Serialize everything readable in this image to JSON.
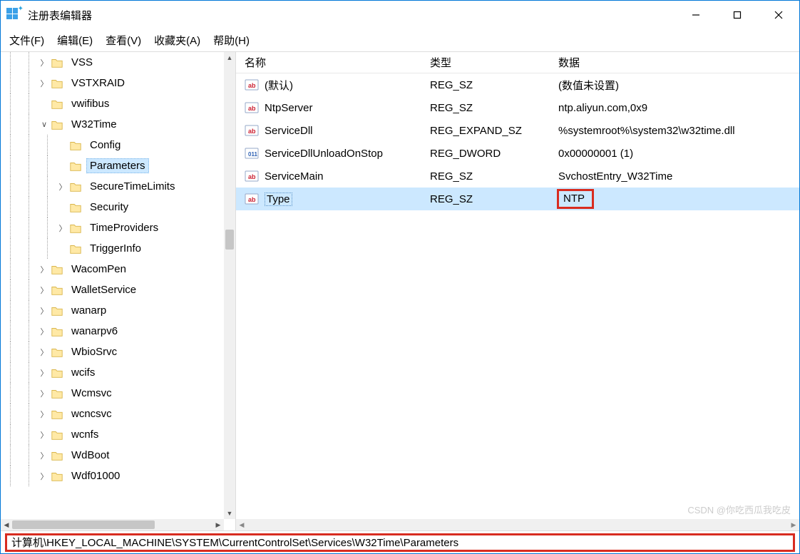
{
  "window": {
    "title": "注册表编辑器"
  },
  "menu": {
    "file": "文件(F)",
    "edit": "编辑(E)",
    "view": "查看(V)",
    "fav": "收藏夹(A)",
    "help": "帮助(H)"
  },
  "tree": [
    {
      "d": 2,
      "t": ">",
      "l": "VSS"
    },
    {
      "d": 2,
      "t": ">",
      "l": "VSTXRAID"
    },
    {
      "d": 2,
      "t": "",
      "l": "vwifibus"
    },
    {
      "d": 2,
      "t": "v",
      "l": "W32Time"
    },
    {
      "d": 3,
      "t": "",
      "l": "Config"
    },
    {
      "d": 3,
      "t": "",
      "l": "Parameters",
      "sel": true
    },
    {
      "d": 3,
      "t": ">",
      "l": "SecureTimeLimits"
    },
    {
      "d": 3,
      "t": "",
      "l": "Security"
    },
    {
      "d": 3,
      "t": ">",
      "l": "TimeProviders"
    },
    {
      "d": 3,
      "t": "",
      "l": "TriggerInfo"
    },
    {
      "d": 2,
      "t": ">",
      "l": "WacomPen"
    },
    {
      "d": 2,
      "t": ">",
      "l": "WalletService"
    },
    {
      "d": 2,
      "t": ">",
      "l": "wanarp"
    },
    {
      "d": 2,
      "t": ">",
      "l": "wanarpv6"
    },
    {
      "d": 2,
      "t": ">",
      "l": "WbioSrvc"
    },
    {
      "d": 2,
      "t": ">",
      "l": "wcifs"
    },
    {
      "d": 2,
      "t": ">",
      "l": "Wcmsvc"
    },
    {
      "d": 2,
      "t": ">",
      "l": "wcncsvc"
    },
    {
      "d": 2,
      "t": ">",
      "l": "wcnfs"
    },
    {
      "d": 2,
      "t": ">",
      "l": "WdBoot"
    },
    {
      "d": 2,
      "t": ">",
      "l": "Wdf01000"
    }
  ],
  "list": {
    "headers": {
      "name": "名称",
      "type": "类型",
      "data": "数据"
    },
    "rows": [
      {
        "ic": "sz",
        "n": "(默认)",
        "t": "REG_SZ",
        "d": "(数值未设置)"
      },
      {
        "ic": "sz",
        "n": "NtpServer",
        "t": "REG_SZ",
        "d": "ntp.aliyun.com,0x9"
      },
      {
        "ic": "sz",
        "n": "ServiceDll",
        "t": "REG_EXPAND_SZ",
        "d": "%systemroot%\\system32\\w32time.dll"
      },
      {
        "ic": "dw",
        "n": "ServiceDllUnloadOnStop",
        "t": "REG_DWORD",
        "d": "0x00000001 (1)"
      },
      {
        "ic": "sz",
        "n": "ServiceMain",
        "t": "REG_SZ",
        "d": "SvchostEntry_W32Time"
      },
      {
        "ic": "sz",
        "n": "Type",
        "t": "REG_SZ",
        "d": "NTP",
        "sel": true,
        "box": true
      }
    ]
  },
  "path": "计算机\\HKEY_LOCAL_MACHINE\\SYSTEM\\CurrentControlSet\\Services\\W32Time\\Parameters",
  "watermark": "CSDN @你吃西瓜我吃皮"
}
